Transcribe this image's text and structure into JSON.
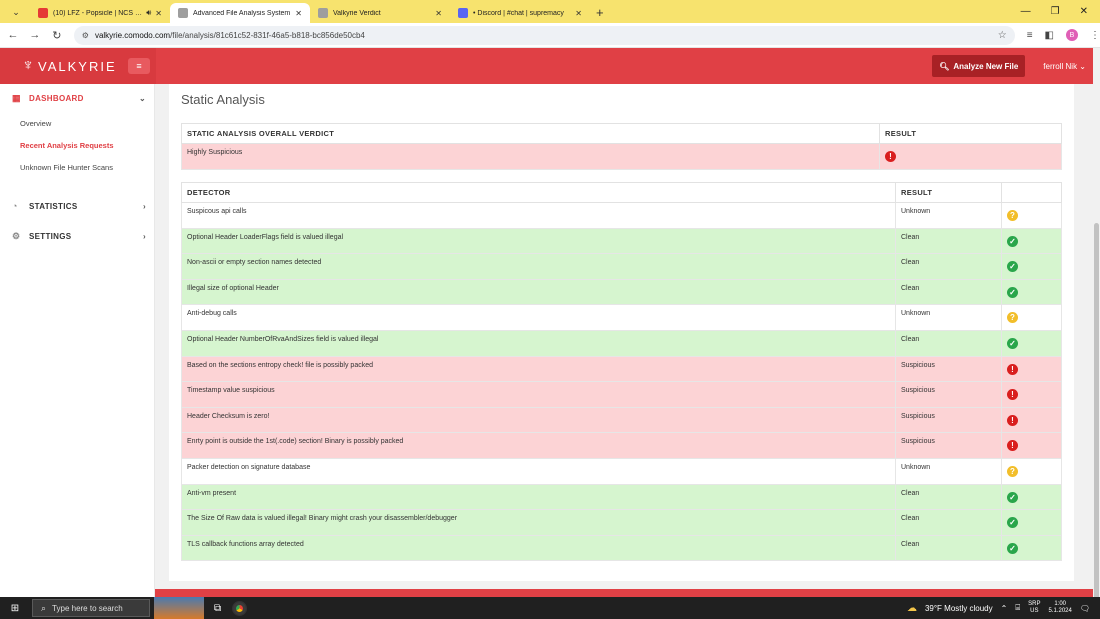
{
  "browser": {
    "tabs": [
      {
        "title": "(10) LFZ - Popsicle | NCS - C",
        "favicon_color": "#e53935",
        "active": false
      },
      {
        "title": "Advanced File Analysis System",
        "favicon_color": "#9e9e9e",
        "active": true
      },
      {
        "title": "Valkyrie Verdict",
        "favicon_color": "#9e9e9e",
        "active": false
      },
      {
        "title": "• Discord | #chat | supremacy",
        "favicon_color": "#5865f2",
        "active": false
      }
    ],
    "url_host": "valkyrie.comodo.com",
    "url_path": "/file/analysis/81c61c52-831f-46a5-b818-bc856de50cb4",
    "profile_initial": "B"
  },
  "app": {
    "brand": "VALKYRIE",
    "analyze_button": "Analyze New File",
    "user": "ferroll Nik"
  },
  "sidebar": {
    "dashboard": "DASHBOARD",
    "dashboard_items": [
      "Overview",
      "Recent Analysis Requests",
      "Unknown File Hunter Scans"
    ],
    "statistics": "STATISTICS",
    "settings": "SETTINGS"
  },
  "main": {
    "title": "Static Analysis",
    "verdict_header": "STATIC ANALYSIS OVERALL VERDICT",
    "result_header": "RESULT",
    "verdict_value": "Highly Suspicious",
    "detector_header": "DETECTOR",
    "detectors": [
      {
        "name": "Suspicous api calls",
        "result": "Unknown",
        "status": "unknown"
      },
      {
        "name": "Optional Header LoaderFlags field is valued illegal",
        "result": "Clean",
        "status": "clean"
      },
      {
        "name": "Non-ascii or empty section names detected",
        "result": "Clean",
        "status": "clean"
      },
      {
        "name": "Illegal size of optional Header",
        "result": "Clean",
        "status": "clean"
      },
      {
        "name": "Anti-debug calls",
        "result": "Unknown",
        "status": "unknown"
      },
      {
        "name": "Optional Header NumberOfRvaAndSizes field is valued illegal",
        "result": "Clean",
        "status": "clean"
      },
      {
        "name": "Based on the sections entropy check! file is possibly packed",
        "result": "Suspicious",
        "status": "suspicious"
      },
      {
        "name": "Timestamp value suspicious",
        "result": "Suspicious",
        "status": "suspicious"
      },
      {
        "name": "Header Checksum is zero!",
        "result": "Suspicious",
        "status": "suspicious"
      },
      {
        "name": "Enrty point is outside the 1st(.code) section! Binary is possibly packed",
        "result": "Suspicious",
        "status": "suspicious"
      },
      {
        "name": "Packer detection on signature database",
        "result": "Unknown",
        "status": "unknown"
      },
      {
        "name": "Anti-vm present",
        "result": "Clean",
        "status": "clean"
      },
      {
        "name": "The Size Of Raw data is valued illegal! Binary might crash your disassembler/debugger",
        "result": "Clean",
        "status": "clean"
      },
      {
        "name": "TLS callback functions array detected",
        "result": "Clean",
        "status": "clean"
      }
    ]
  },
  "taskbar": {
    "search_placeholder": "Type here to search",
    "weather": "39°F  Mostly cloudy",
    "lang": "SRP",
    "region": "US",
    "time": "1:00",
    "date": "5.1.2024"
  }
}
